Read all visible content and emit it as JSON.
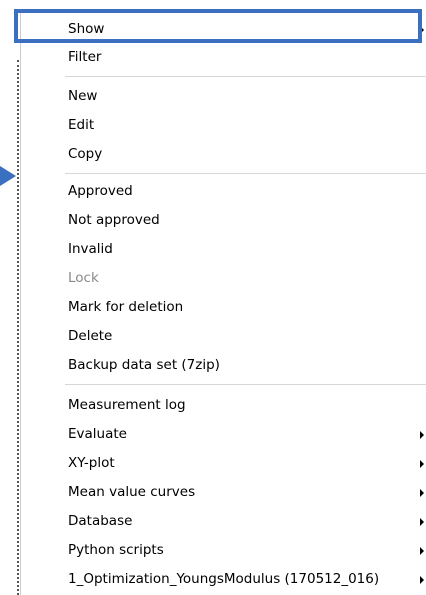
{
  "menu": {
    "items": [
      {
        "label": "Show",
        "submenu": true,
        "enabled": true
      },
      {
        "label": "Filter",
        "submenu": false,
        "enabled": true
      },
      {
        "label": "New",
        "submenu": false,
        "enabled": true
      },
      {
        "label": "Edit",
        "submenu": false,
        "enabled": true
      },
      {
        "label": "Copy",
        "submenu": false,
        "enabled": true
      },
      {
        "label": "Approved",
        "submenu": false,
        "enabled": true
      },
      {
        "label": "Not approved",
        "submenu": false,
        "enabled": true
      },
      {
        "label": "Invalid",
        "submenu": false,
        "enabled": true
      },
      {
        "label": "Lock",
        "submenu": false,
        "enabled": false
      },
      {
        "label": "Mark for deletion",
        "submenu": false,
        "enabled": true
      },
      {
        "label": "Delete",
        "submenu": false,
        "enabled": true
      },
      {
        "label": "Backup data set (7zip)",
        "submenu": false,
        "enabled": true
      },
      {
        "label": "Measurement log",
        "submenu": false,
        "enabled": true
      },
      {
        "label": "Evaluate",
        "submenu": true,
        "enabled": true
      },
      {
        "label": "XY-plot",
        "submenu": true,
        "enabled": true
      },
      {
        "label": "Mean value curves",
        "submenu": true,
        "enabled": true
      },
      {
        "label": "Database",
        "submenu": true,
        "enabled": true
      },
      {
        "label": "Python scripts",
        "submenu": true,
        "enabled": true
      },
      {
        "label": "1_Optimization_YoungsModulus (170512_016)",
        "submenu": true,
        "enabled": true
      }
    ]
  },
  "highlight": {
    "color": "#3d6fc0",
    "target": "Show"
  },
  "pointer_arrow": {
    "color": "#3a6fc2"
  }
}
